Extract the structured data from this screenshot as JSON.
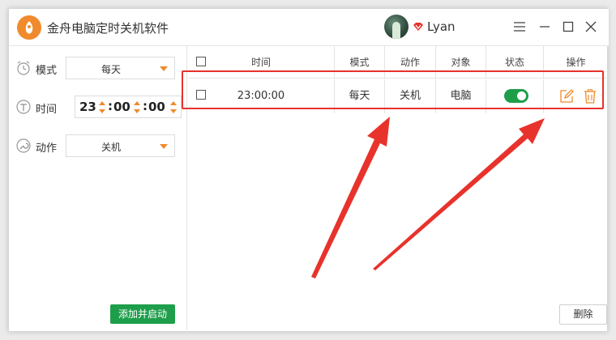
{
  "window": {
    "app_title": "金舟电脑定时关机软件",
    "username": "Lyan",
    "icons": [
      "app-logo-icon",
      "vip-icon",
      "menu-icon",
      "minimize-icon",
      "maximize-icon",
      "close-icon"
    ]
  },
  "form": {
    "mode_label": "模式",
    "mode_value": "每天",
    "time_label": "时间",
    "time_hour": "23",
    "time_minute": "00",
    "time_second": "00",
    "time_sep": ":",
    "action_label": "动作",
    "action_value": "关机",
    "add_button": "添加并启动"
  },
  "table": {
    "headers": [
      "时间",
      "模式",
      "动作",
      "对象",
      "状态",
      "操作"
    ],
    "rows": [
      {
        "time": "23:00:00",
        "mode": "每天",
        "action": "关机",
        "target": "电脑",
        "enabled": true
      }
    ],
    "delete_button": "删除"
  },
  "colors": {
    "accent": "#f08a2c",
    "green": "#1e9e4a",
    "annotation": "#e8322c"
  }
}
